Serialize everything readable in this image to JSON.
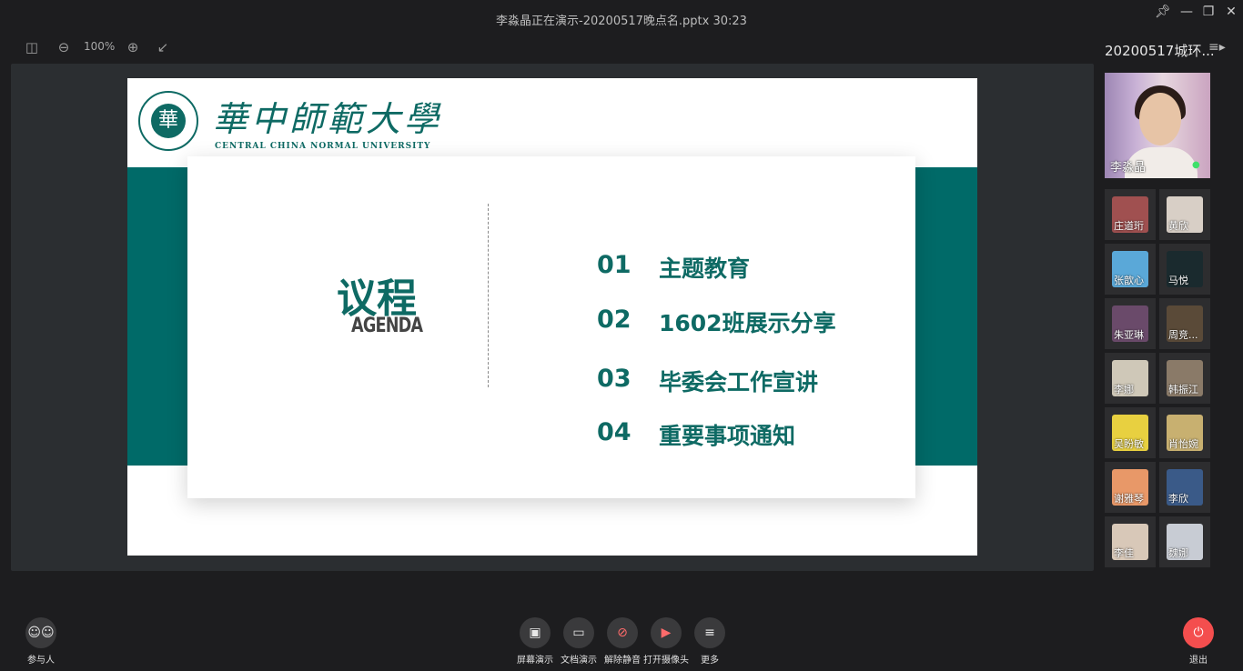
{
  "window": {
    "title": "李淼晶正在演示-20200517晚点名.pptx 30:23"
  },
  "toolbar": {
    "zoom": "100%"
  },
  "slide": {
    "logo_cn": "華中師範大學",
    "logo_en": "CENTRAL CHINA NORMAL UNIVERSITY",
    "logo_seal_char": "華",
    "heading_cn": "议程",
    "heading_en": "AGENDA",
    "items": [
      {
        "num": "01",
        "text": "主题教育"
      },
      {
        "num": "02",
        "text": "1602班展示分享"
      },
      {
        "num": "03",
        "text": "毕委会工作宣讲"
      },
      {
        "num": "04",
        "text": "重要事项通知"
      }
    ]
  },
  "sidebar": {
    "meeting_name": "20200517城环...",
    "host_name": "李淼晶",
    "participants": [
      {
        "name": "庄道珩",
        "color": "#a05050"
      },
      {
        "name": "黄欣",
        "color": "#d8cfc6"
      },
      {
        "name": "张歆心",
        "color": "#5aa8d8"
      },
      {
        "name": "马悦",
        "color": "#1a2a2e"
      },
      {
        "name": "朱亚琳",
        "color": "#6a4a6a"
      },
      {
        "name": "周竞...",
        "color": "#5a4a38"
      },
      {
        "name": "李娜",
        "color": "#cfc8b8"
      },
      {
        "name": "韩振江",
        "color": "#8a7a68"
      },
      {
        "name": "吴盼敏",
        "color": "#e8d040"
      },
      {
        "name": "肖怡婉",
        "color": "#c8b070"
      },
      {
        "name": "谢雅琴",
        "color": "#e89868"
      },
      {
        "name": "李欣",
        "color": "#3a5a88"
      },
      {
        "name": "李佳",
        "color": "#d8c8b8"
      },
      {
        "name": "魏娜",
        "color": "#c8ccd4"
      }
    ]
  },
  "controls": {
    "participants_label": "参与人",
    "screen_share_label": "屏幕演示",
    "doc_share_label": "文档演示",
    "unmute_label": "解除静音",
    "camera_label": "打开摄像头",
    "more_label": "更多",
    "exit_label": "退出"
  }
}
